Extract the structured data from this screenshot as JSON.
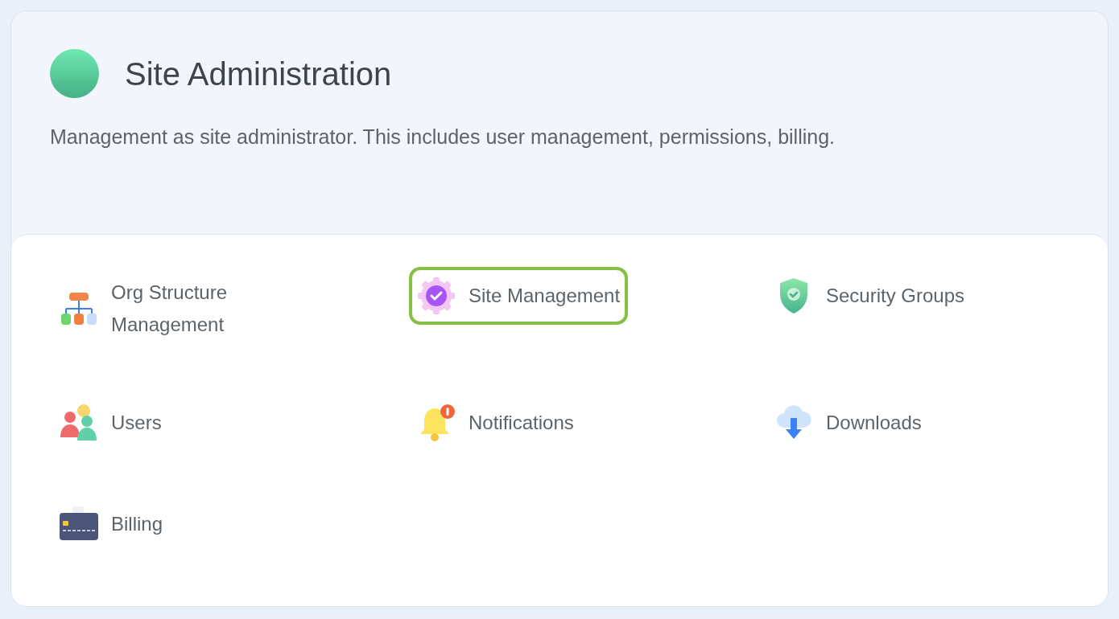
{
  "header": {
    "title": "Site Administration",
    "description": "Management as site administrator. This includes user management, permissions, billing."
  },
  "items": [
    {
      "label": "Org Structure Management",
      "kind": "org",
      "selected": false
    },
    {
      "label": "Site Management",
      "kind": "gear",
      "selected": true
    },
    {
      "label": "Security Groups",
      "kind": "shield",
      "selected": false
    },
    {
      "label": "Users",
      "kind": "users",
      "selected": false
    },
    {
      "label": "Notifications",
      "kind": "bell",
      "selected": false
    },
    {
      "label": "Downloads",
      "kind": "download",
      "selected": false
    },
    {
      "label": "Billing",
      "kind": "card",
      "selected": false
    }
  ]
}
